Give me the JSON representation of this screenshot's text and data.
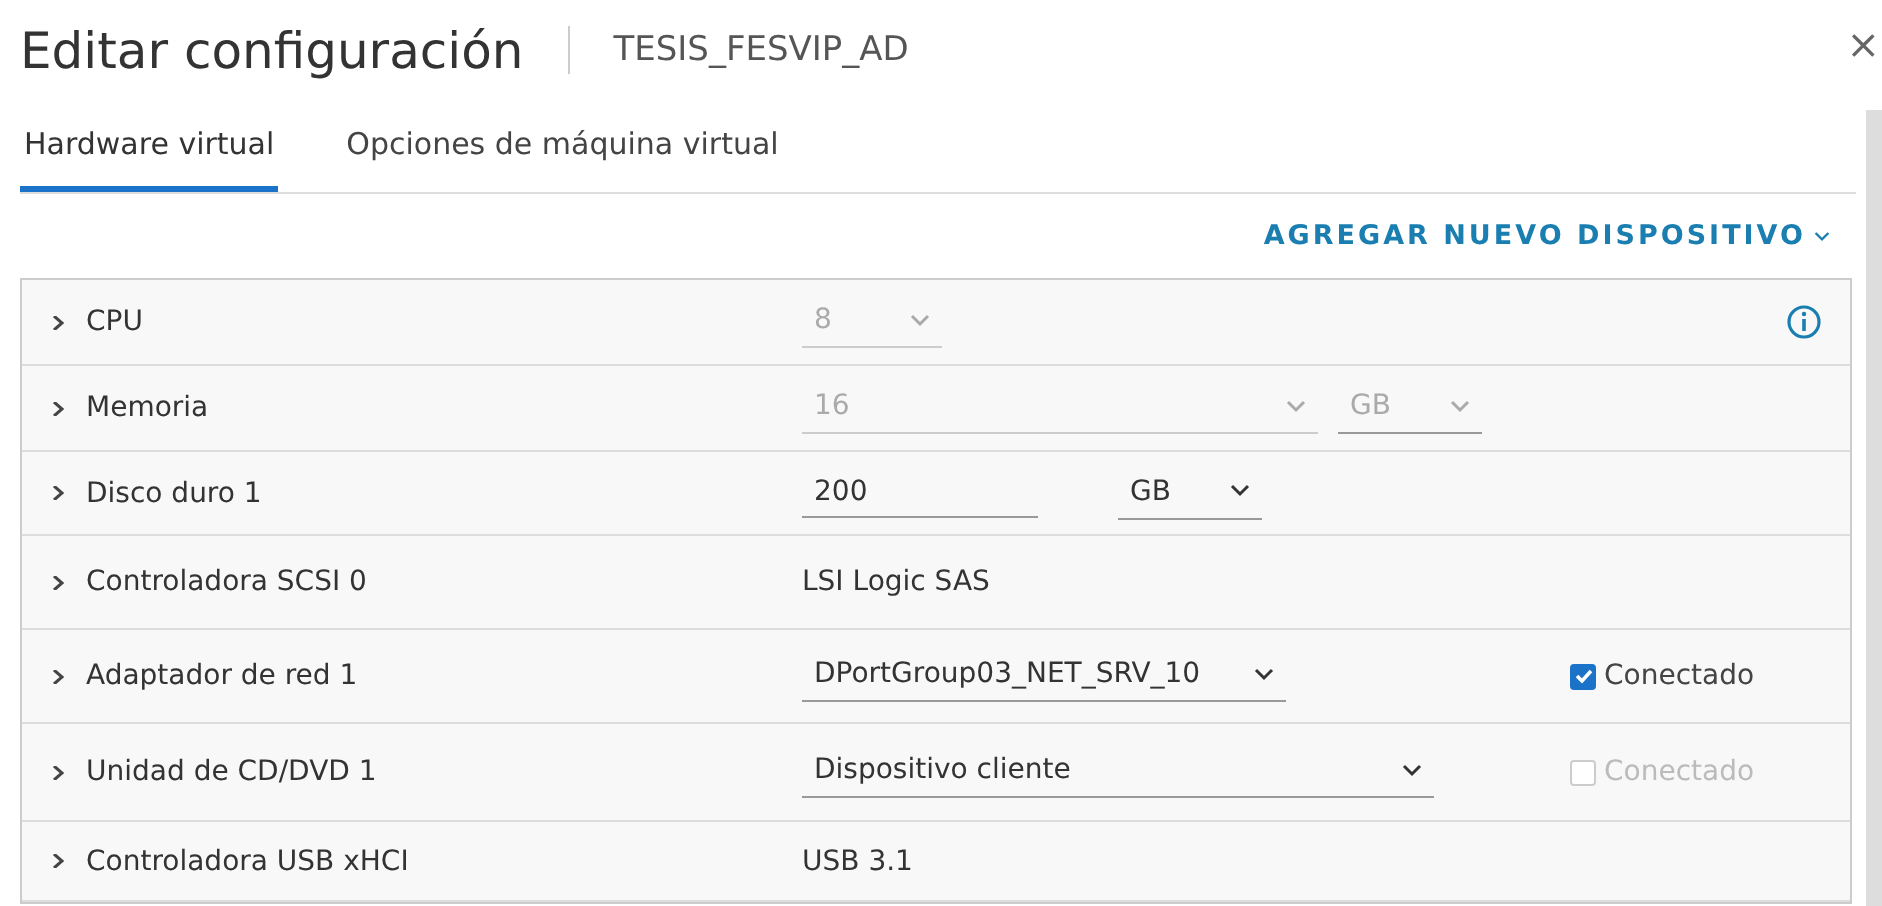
{
  "window": {
    "title": "Editar configuración",
    "subtitle": "TESIS_FESVIP_AD",
    "close": "×"
  },
  "tabs": [
    {
      "label": "Hardware virtual",
      "selected": true
    },
    {
      "label": "Opciones de máquina virtual",
      "selected": false
    }
  ],
  "add_device": {
    "label": "AGREGAR NUEVO DISPOSITIVO"
  },
  "rows": [
    {
      "kind": "select",
      "label": "CPU",
      "value": "8",
      "disabled": true,
      "info": true
    },
    {
      "kind": "select",
      "label": "Memoria",
      "value": "16",
      "disabled": true,
      "unit": {
        "value": "GB",
        "disabled": true
      }
    },
    {
      "kind": "input",
      "label": "Disco duro 1",
      "value": "200",
      "unit": {
        "value": "GB",
        "disabled": false
      }
    },
    {
      "kind": "text",
      "label": "Controladora SCSI 0",
      "value": "LSI Logic SAS"
    },
    {
      "kind": "select",
      "label": "Adaptador de red 1",
      "value": "DPortGroup03_NET_SRV_10",
      "disabled": false,
      "checkbox": {
        "label": "Conectado",
        "checked": true,
        "disabled": false
      }
    },
    {
      "kind": "select",
      "label": "Unidad de CD/DVD 1",
      "value": "Dispositivo cliente",
      "disabled": false,
      "checkbox": {
        "label": "Conectado",
        "checked": false,
        "disabled": true
      }
    },
    {
      "kind": "text",
      "label": "Controladora USB xHCI",
      "value": "USB 3.1"
    }
  ]
}
